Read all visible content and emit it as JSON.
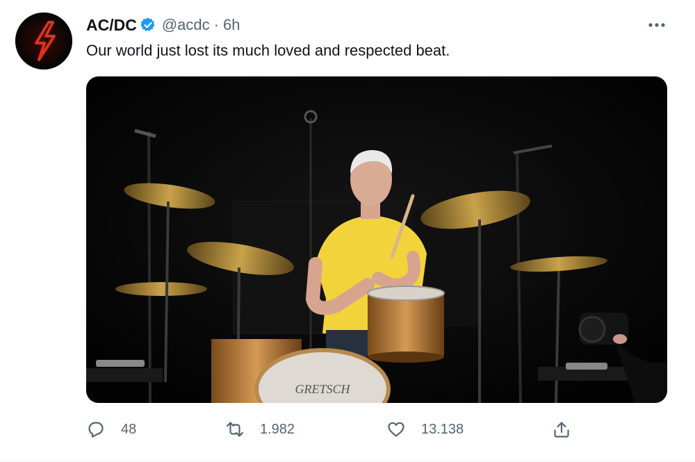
{
  "tweet": {
    "author_name": "AC/DC",
    "handle": "@acdc",
    "separator": "·",
    "time": "6h",
    "text": "Our world just lost its much loved and respected beat.",
    "avatar_icon": "lightning-bolt-icon",
    "verified_icon": "verified-badge-icon",
    "verified_color": "#1d9bf0",
    "media_alt": "drummer in yellow shirt playing drum kit on stage",
    "drum_brand": "GRETSCH"
  },
  "actions": {
    "reply": {
      "icon": "reply-icon",
      "count": "48"
    },
    "retweet": {
      "icon": "retweet-icon",
      "count": "1.982"
    },
    "like": {
      "icon": "heart-icon",
      "count": "13.138"
    },
    "share": {
      "icon": "share-icon"
    }
  },
  "colors": {
    "text": "#0f1419",
    "secondary": "#536471",
    "avatar_bolt": "#e0301e"
  }
}
